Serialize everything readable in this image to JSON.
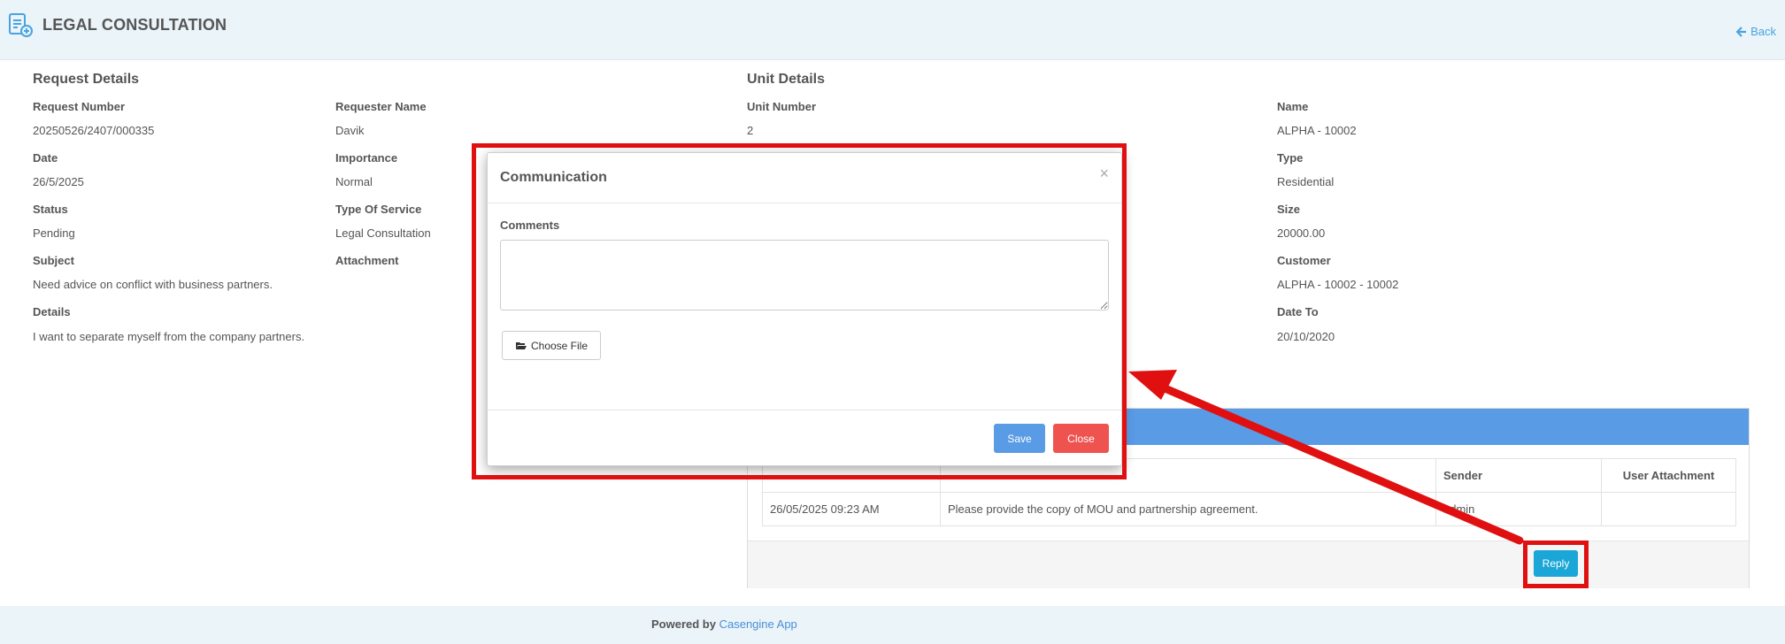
{
  "header": {
    "title": "LEGAL CONSULTATION",
    "back_label": "Back"
  },
  "request_details": {
    "section_title": "Request Details",
    "request_number_label": "Request Number",
    "request_number": "20250526/2407/000335",
    "requester_name_label": "Requester Name",
    "requester_name": "Davik",
    "date_label": "Date",
    "date": "26/5/2025",
    "importance_label": "Importance",
    "importance": "Normal",
    "status_label": "Status",
    "status": "Pending",
    "type_of_service_label": "Type Of Service",
    "type_of_service": "Legal Consultation",
    "subject_label": "Subject",
    "subject": "Need advice on conflict with business partners.",
    "attachment_label": "Attachment",
    "details_label": "Details",
    "details": "I want to separate myself from the company partners."
  },
  "unit_details": {
    "section_title": "Unit Details",
    "unit_number_label": "Unit Number",
    "unit_number": "2",
    "name_label": "Name",
    "name": "ALPHA - 10002",
    "type_label": "Type",
    "type": "Residential",
    "size_label": "Size",
    "size": "20000.00",
    "customer_label": "Customer",
    "customer": "ALPHA - 10002 - 10002",
    "date_to_label": "Date To",
    "date_to": "20/10/2020"
  },
  "communication_table": {
    "columns": [
      "",
      "",
      "Sender",
      "User Attachment"
    ],
    "rows": [
      {
        "date": "26/05/2025 09:23 AM",
        "message": "Please provide the copy of MOU and partnership agreement.",
        "sender": "admin",
        "attachment": ""
      }
    ],
    "reply_label": "Reply"
  },
  "modal": {
    "title": "Communication",
    "close_x": "×",
    "comments_label": "Comments",
    "comments_value": "",
    "choose_file_label": "Choose File",
    "save_label": "Save",
    "close_label": "Close"
  },
  "footer": {
    "powered_by": "Powered by",
    "brand": "Casengine App"
  },
  "colors": {
    "header_bg": "#eaf4f9",
    "link_blue": "#4aa3df",
    "panel_blue": "#5a9be6",
    "reply_blue": "#1aa6d6",
    "close_red": "#ef5350",
    "annotation_red": "#e01010"
  },
  "icons": {
    "app": "document-add-icon",
    "back": "arrow-left-icon",
    "file": "folder-open-icon"
  }
}
